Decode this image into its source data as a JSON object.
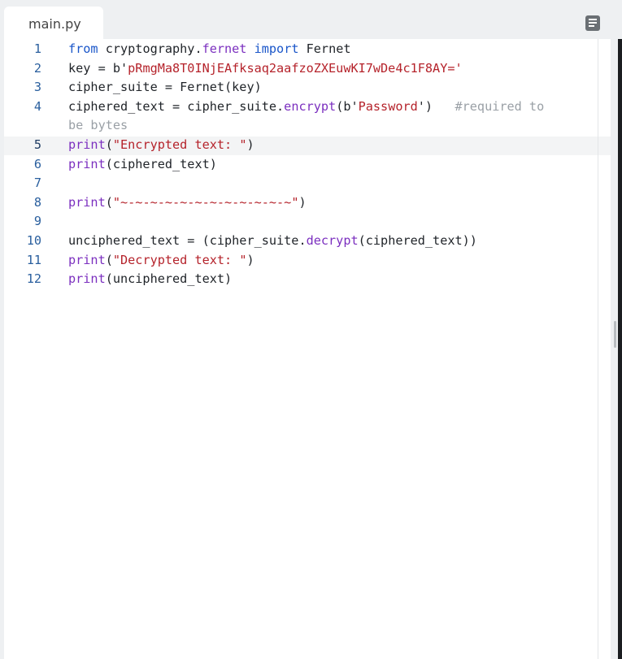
{
  "tab": {
    "label": "main.py"
  },
  "lines": [
    {
      "num": "1",
      "tokens": [
        {
          "t": "kw",
          "v": "from"
        },
        {
          "t": "pl",
          "v": " cryptography."
        },
        {
          "t": "at",
          "v": "fernet"
        },
        {
          "t": "pl",
          "v": " "
        },
        {
          "t": "kw",
          "v": "import"
        },
        {
          "t": "pl",
          "v": " Fernet"
        }
      ]
    },
    {
      "num": "2",
      "tokens": [
        {
          "t": "pl",
          "v": "key = b'"
        },
        {
          "t": "str",
          "v": "pRmgMa8T0INjEAfksaq2aafzoZXEuwKI7wDe4c1F8AY="
        },
        {
          "t": "str",
          "v": "'"
        }
      ]
    },
    {
      "num": "3",
      "tokens": [
        {
          "t": "pl",
          "v": "cipher_suite = Fernet(key)"
        }
      ]
    },
    {
      "num": "4",
      "wrapped": true,
      "tokens": [
        {
          "t": "pl",
          "v": "ciphered_text = cipher_suite."
        },
        {
          "t": "fn",
          "v": "encrypt"
        },
        {
          "t": "pl",
          "v": "(b'"
        },
        {
          "t": "str",
          "v": "Password"
        },
        {
          "t": "pl",
          "v": "')   "
        },
        {
          "t": "cm",
          "v": "#required to\nbe bytes"
        }
      ]
    },
    {
      "num": "5",
      "active": true,
      "tokens": [
        {
          "t": "fn",
          "v": "print"
        },
        {
          "t": "pl",
          "v": "("
        },
        {
          "t": "str",
          "v": "\"Encrypted text: \""
        },
        {
          "t": "pl",
          "v": ")"
        }
      ]
    },
    {
      "num": "6",
      "tokens": [
        {
          "t": "fn",
          "v": "print"
        },
        {
          "t": "pl",
          "v": "(ciphered_text)"
        }
      ]
    },
    {
      "num": "7",
      "tokens": []
    },
    {
      "num": "8",
      "tokens": [
        {
          "t": "fn",
          "v": "print"
        },
        {
          "t": "pl",
          "v": "("
        },
        {
          "t": "str",
          "v": "\"~-~-~-~-~-~-~-~-~-~-~-~\""
        },
        {
          "t": "pl",
          "v": ")"
        }
      ]
    },
    {
      "num": "9",
      "tokens": []
    },
    {
      "num": "10",
      "tokens": [
        {
          "t": "pl",
          "v": "unciphered_text = (cipher_suite."
        },
        {
          "t": "fn",
          "v": "decrypt"
        },
        {
          "t": "pl",
          "v": "(ciphered_text))"
        }
      ]
    },
    {
      "num": "11",
      "tokens": [
        {
          "t": "fn",
          "v": "print"
        },
        {
          "t": "pl",
          "v": "("
        },
        {
          "t": "str",
          "v": "\"Decrypted text: \""
        },
        {
          "t": "pl",
          "v": ")"
        }
      ]
    },
    {
      "num": "12",
      "tokens": [
        {
          "t": "fn",
          "v": "print"
        },
        {
          "t": "pl",
          "v": "(unciphered_text)"
        }
      ]
    }
  ],
  "icons": {
    "tab_menu": "list-menu-icon"
  },
  "colors": {
    "keyword": "#1a56c9",
    "function": "#7b2fbf",
    "string": "#b5232b",
    "comment": "#9aa0a6",
    "line_number": "#2a5f9e"
  }
}
